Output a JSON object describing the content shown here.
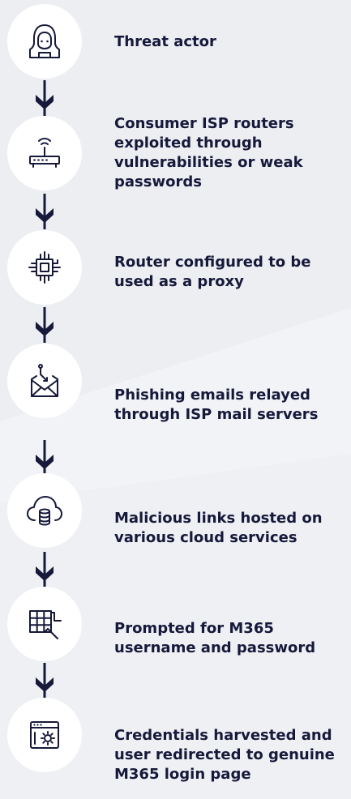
{
  "steps": [
    {
      "icon": "hacker-icon",
      "label": "Threat actor"
    },
    {
      "icon": "router-icon",
      "label": "Consumer ISP routers exploited through vulnerabilities or weak passwords"
    },
    {
      "icon": "chip-icon",
      "label": "Router configured to be used as a proxy"
    },
    {
      "icon": "email-icon",
      "label": "Phishing emails relayed through ISP mail servers"
    },
    {
      "icon": "cloud-database-icon",
      "label": "Malicious links hosted on various cloud services"
    },
    {
      "icon": "password-grid-icon",
      "label": "Prompted for M365 username and password"
    },
    {
      "icon": "browser-settings-icon",
      "label": "Credentials harvested and user redirected to genuine M365 login page"
    }
  ],
  "colors": {
    "text": "#16193a",
    "circle": "#ffffff",
    "background": "#f1f3f6"
  }
}
